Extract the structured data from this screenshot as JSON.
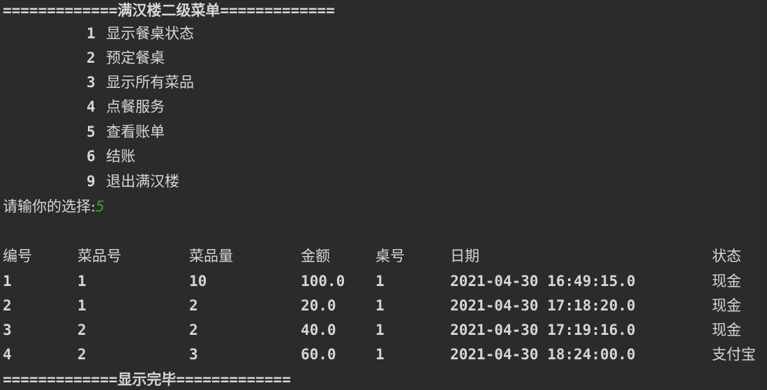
{
  "header_line": "=============满汉楼二级菜单=============",
  "menu": [
    {
      "num": "1",
      "label": "显示餐桌状态"
    },
    {
      "num": "2",
      "label": "预定餐桌"
    },
    {
      "num": "3",
      "label": "显示所有菜品"
    },
    {
      "num": "4",
      "label": "点餐服务"
    },
    {
      "num": "5",
      "label": "查看账单"
    },
    {
      "num": "6",
      "label": "结账"
    },
    {
      "num": "9",
      "label": "退出满汉楼"
    }
  ],
  "prompt": {
    "text": "请输你的选择:",
    "value": "5"
  },
  "table": {
    "headers": [
      "编号",
      "菜品号",
      "菜品量",
      "金额",
      "桌号",
      "日期",
      "状态"
    ],
    "rows": [
      [
        "1",
        "1",
        "10",
        "100.0",
        "1",
        "2021-04-30 16:49:15.0",
        "现金"
      ],
      [
        "2",
        "1",
        "2",
        "20.0",
        "1",
        "2021-04-30 17:18:20.0",
        "现金"
      ],
      [
        "3",
        "2",
        "2",
        "40.0",
        "1",
        "2021-04-30 17:19:16.0",
        "现金"
      ],
      [
        "4",
        "2",
        "3",
        "60.0",
        "1",
        "2021-04-30 18:24:00.0",
        "支付宝"
      ]
    ]
  },
  "footer_line": "=============显示完毕============="
}
